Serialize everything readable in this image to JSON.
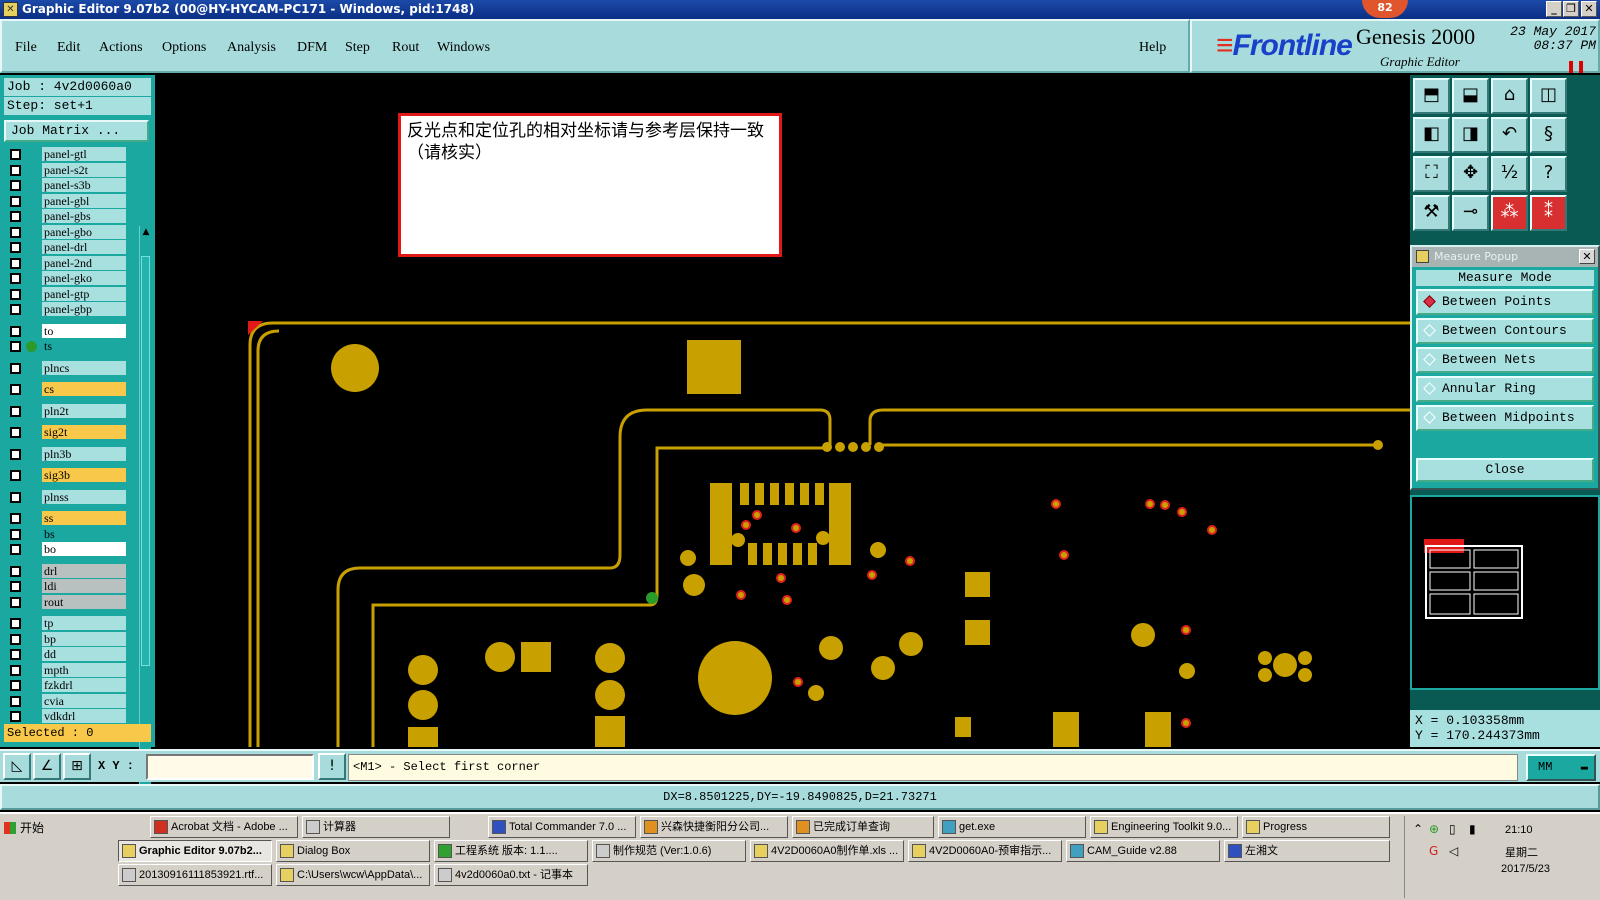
{
  "window": {
    "title": "Graphic Editor 9.07b2 (00@HY-HYCAM-PC171 - Windows, pid:1748)",
    "badge": "82"
  },
  "menu": {
    "items": [
      "File",
      "Edit",
      "Actions",
      "Options",
      "Analysis",
      "DFM",
      "Step",
      "Rout",
      "Windows"
    ],
    "help": "Help"
  },
  "brand": {
    "logo": "Frontline",
    "product": "Genesis 2000",
    "subtitle": "Graphic Editor",
    "date": "23 May 2017",
    "time": "08:37 PM"
  },
  "job": {
    "job_label": "Job : 4v2d0060a0",
    "step_label": "Step: set+1",
    "matrix_button": "Job Matrix ..."
  },
  "layers": [
    {
      "name": "panel-gtl",
      "color": "#a8e0e0"
    },
    {
      "name": "panel-s2t",
      "color": "#a8e0e0"
    },
    {
      "name": "panel-s3b",
      "color": "#a8e0e0"
    },
    {
      "name": "panel-gbl",
      "color": "#a8e0e0"
    },
    {
      "name": "panel-gbs",
      "color": "#a8e0e0"
    },
    {
      "name": "panel-gbo",
      "color": "#a8e0e0"
    },
    {
      "name": "panel-drl",
      "color": "#a8e0e0"
    },
    {
      "name": "panel-2nd",
      "color": "#a8e0e0"
    },
    {
      "name": "panel-gko",
      "color": "#a8e0e0"
    },
    {
      "name": "panel-gtp",
      "color": "#a8e0e0"
    },
    {
      "name": "panel-gbp",
      "color": "#a8e0e0"
    },
    {
      "name": "to",
      "color": "#ffffff"
    },
    {
      "name": "ts",
      "color": "#1aa8a0",
      "active": true
    },
    {
      "name": "plncs",
      "color": "#a8e0e0"
    },
    {
      "name": "cs",
      "color": "#f8c84a"
    },
    {
      "name": "pln2t",
      "color": "#a8e0e0"
    },
    {
      "name": "sig2t",
      "color": "#f8c84a"
    },
    {
      "name": "pln3b",
      "color": "#a8e0e0"
    },
    {
      "name": "sig3b",
      "color": "#f8c84a"
    },
    {
      "name": "plnss",
      "color": "#a8e0e0"
    },
    {
      "name": "ss",
      "color": "#f8c84a"
    },
    {
      "name": "bs",
      "color": "#1aa8a0"
    },
    {
      "name": "bo",
      "color": "#ffffff"
    },
    {
      "name": "drl",
      "color": "#b8c0c0"
    },
    {
      "name": "ldi",
      "color": "#b8c0c0"
    },
    {
      "name": "rout",
      "color": "#b8c0c0"
    },
    {
      "name": "tp",
      "color": "#a8e0e0"
    },
    {
      "name": "bp",
      "color": "#a8e0e0"
    },
    {
      "name": "dd",
      "color": "#a8e0e0"
    },
    {
      "name": "mpth",
      "color": "#a8e0e0"
    },
    {
      "name": "fzkdrl",
      "color": "#a8e0e0"
    },
    {
      "name": "cvia",
      "color": "#a8e0e0"
    },
    {
      "name": "vdkdrl",
      "color": "#a8e0e0"
    }
  ],
  "selected": "Selected : 0",
  "note": {
    "text": "反光点和定位孔的相对坐标请与参考层保持一致（请核实）"
  },
  "measure": {
    "title": "Measure Popup",
    "mode_label": "Measure Mode",
    "options": [
      "Between Points",
      "Between Contours",
      "Between Nets",
      "Annular Ring",
      "Between Midpoints"
    ],
    "selected_option": "Between Points",
    "close": "Close"
  },
  "coords": {
    "x": "X = 0.103358mm",
    "y": "Y = 170.244373mm"
  },
  "command": {
    "xy_label": "X Y :",
    "xy_value": "",
    "prompt": "<M1> - Select first corner",
    "unit": "MM"
  },
  "status": "DX=8.8501225,DY=-19.8490825,D=21.73271",
  "taskbar": {
    "start": "开始",
    "row1": [
      "Acrobat 文档 - Adobe ...",
      "计算器",
      "Total Commander 7.0 ...",
      "兴森快捷衡阳分公司...",
      "已完成订单查询",
      "get.exe",
      "Engineering Toolkit 9.0...",
      "Progress"
    ],
    "row2": [
      "Graphic Editor 9.07b2...",
      "Dialog Box",
      "工程系统 版本: 1.1....",
      "制作规范 (Ver:1.0.6)",
      "4V2D0060A0制作单.xls ...",
      "4V2D0060A0-预审指示...",
      "CAM_Guide v2.88",
      "左湘文"
    ],
    "row3": [
      "20130916111853921.rtf...",
      "C:\\Users\\wcw\\AppData\\...",
      "4v2d0060a0.txt - 记事本"
    ],
    "clock_time": "21:10",
    "clock_day": "星期二",
    "clock_date": "2017/5/23"
  }
}
